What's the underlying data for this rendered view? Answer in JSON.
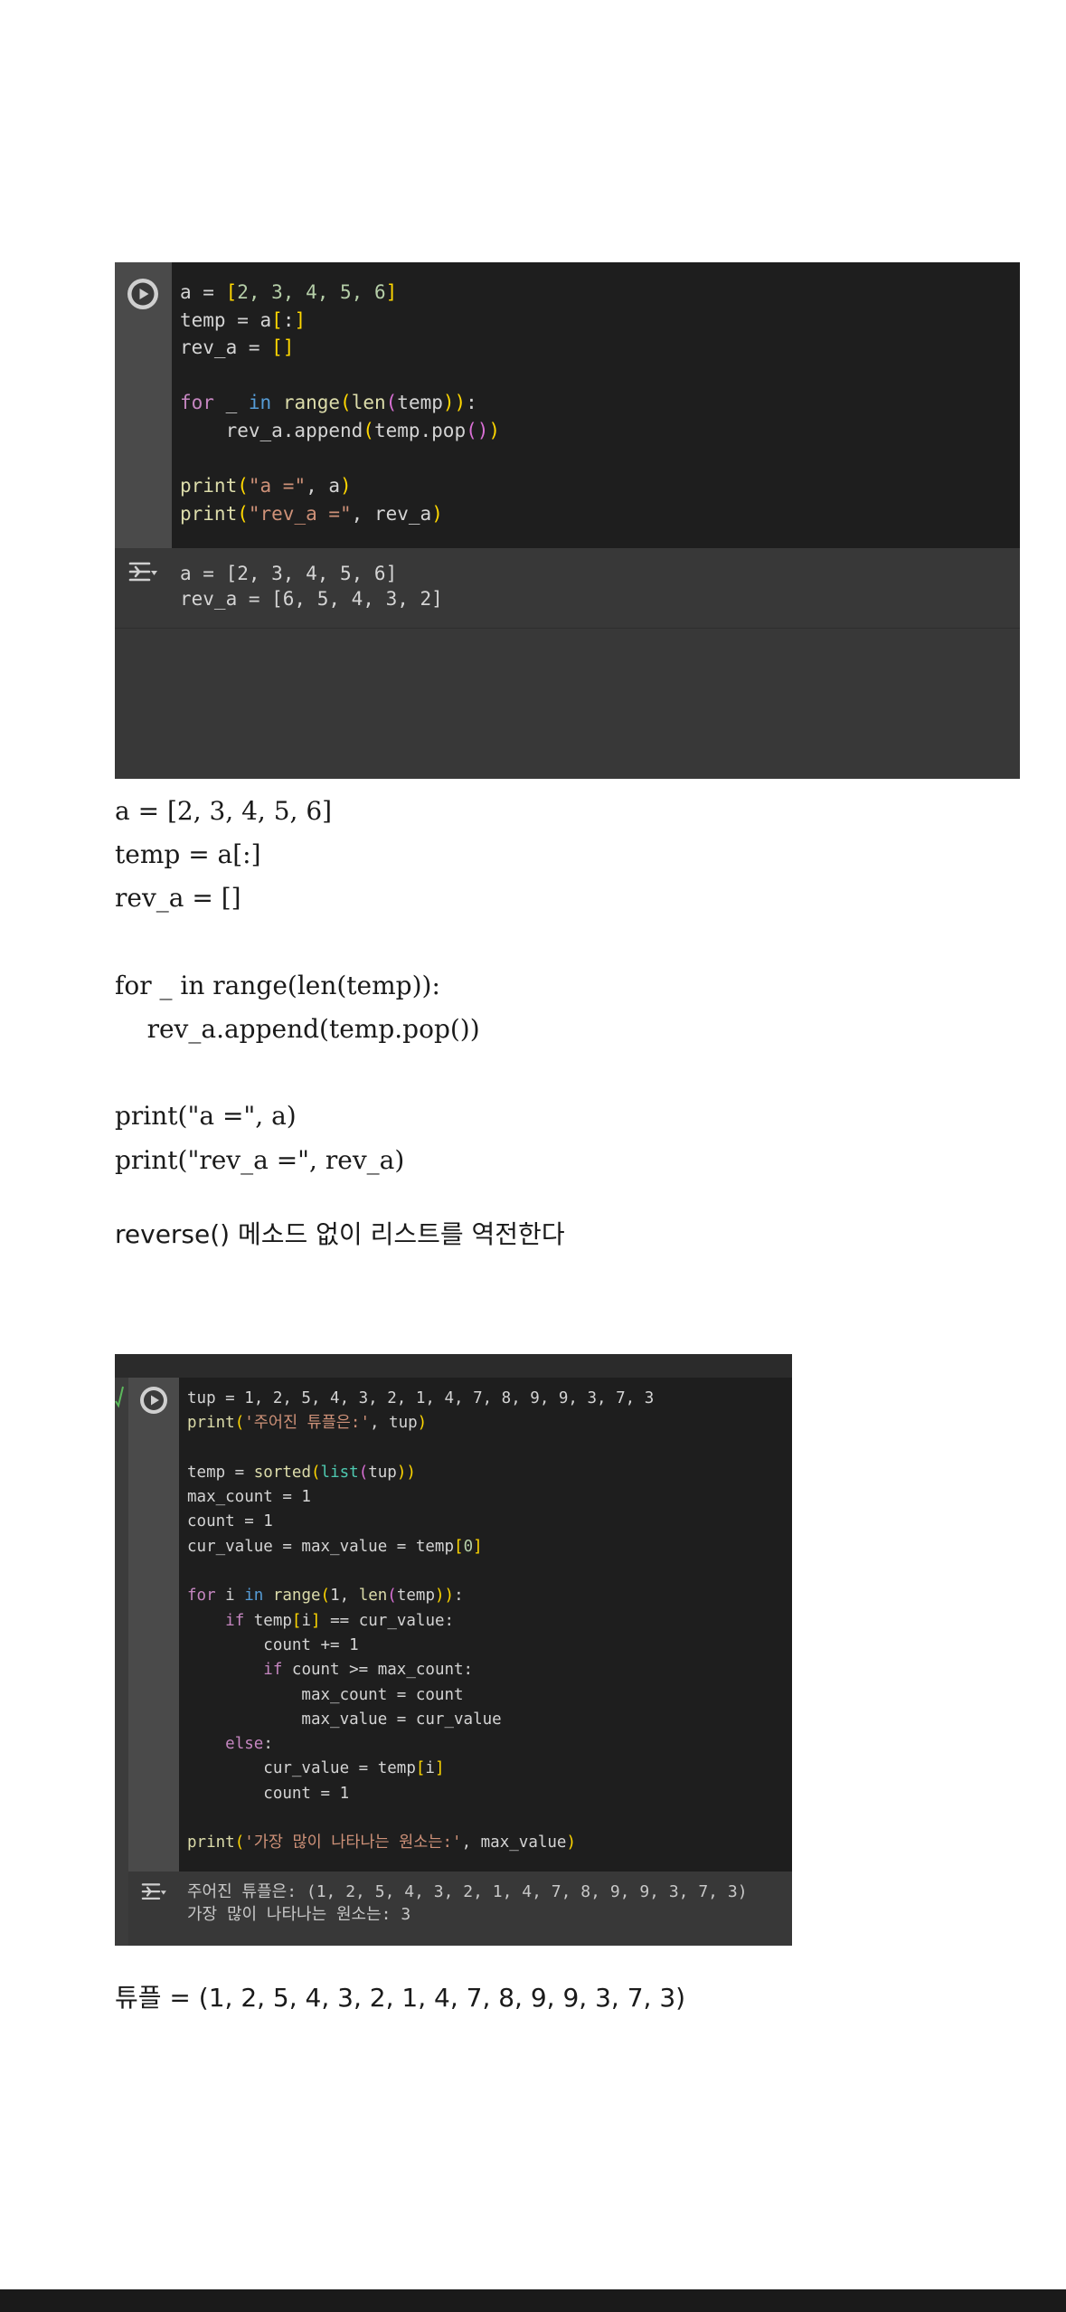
{
  "cell1": {
    "code": {
      "l1": {
        "a": "a = ",
        "b1": "[",
        "nums": "2, 3, 4, 5, 6",
        "b2": "]"
      },
      "l2": {
        "a": "temp = a",
        "b1": "[",
        "mid": ":",
        "b2": "]"
      },
      "l3": {
        "a": "rev_a = ",
        "b": "[]"
      },
      "l5": {
        "kw": "for",
        "a": " _ ",
        "in": "in",
        "sp": " ",
        "range": "range",
        "p1": "(",
        "len": "len",
        "p2": "(",
        "temp": "temp",
        "p3": "))",
        "colon": ":"
      },
      "l6": {
        "a": "    rev_a.append",
        "p1": "(",
        "b": "temp.pop",
        "p2": "()",
        "p3": ")"
      },
      "l8": {
        "fn": "print",
        "p1": "(",
        "str": "\"a =\"",
        "rest": ", a",
        "p2": ")"
      },
      "l9": {
        "fn": "print",
        "p1": "(",
        "str": "\"rev_a =\"",
        "rest": ", rev_a",
        "p2": ")"
      }
    },
    "output": [
      "a = [2, 3, 4, 5, 6]",
      "rev_a = [6, 5, 4, 3, 2]"
    ]
  },
  "explanation": [
    "a = [2, 3, 4, 5, 6]",
    "temp = a[:]",
    "rev_a = []",
    "",
    "for _ in range(len(temp)):",
    "    rev_a.append(temp.pop())",
    "",
    "print(\"a =\", a)",
    "print(\"rev_a =\", rev_a)"
  ],
  "description": "reverse() 메소드 없이 리스트를 역전한다",
  "cell2": {
    "code": {
      "l1": "tup = 1, 2, 5, 4, 3, 2, 1, 4, 7, 8, 9, 9, 3, 7, 3",
      "l2": {
        "fn": "print",
        "p1": "(",
        "str": "'주어진 튜플은:'",
        "rest": ", tup",
        "p2": ")"
      },
      "l4": {
        "a": "temp = ",
        "fn": "sorted",
        "p1": "(",
        "bi": "list",
        "p2": "(",
        "b": "tup",
        "p3": "))"
      },
      "l5": "max_count = 1",
      "l6": "count = 1",
      "l7": {
        "a": "cur_value = max_value = temp",
        "b1": "[",
        "n": "0",
        "b2": "]"
      },
      "l9": {
        "kw": "for",
        "a": " i ",
        "in": "in",
        "sp": " ",
        "range": "range",
        "p1": "(",
        "b": "1, ",
        "len": "len",
        "p2": "(",
        "t": "temp",
        "p3": "))",
        "c": ":"
      },
      "l10": {
        "ind": "    ",
        "kw": "if",
        "a": " temp",
        "b1": "[",
        "i": "i",
        "b2": "]",
        "rest": " == cur_value:"
      },
      "l11": "        count += 1",
      "l12": {
        "ind": "        ",
        "kw": "if",
        "rest": " count >= max_count:"
      },
      "l13": "            max_count = count",
      "l14": "            max_value = cur_value",
      "l15": {
        "ind": "    ",
        "kw": "else",
        "rest": ":"
      },
      "l16": {
        "a": "        cur_value = temp",
        "b1": "[",
        "i": "i",
        "b2": "]"
      },
      "l17": "        count = 1",
      "l19": {
        "fn": "print",
        "p1": "(",
        "str": "'가장 많이 나타나는 원소는:'",
        "rest": ", max_value",
        "p2": ")"
      }
    },
    "output": [
      "주어진 튜플은: (1, 2, 5, 4, 3, 2, 1, 4, 7, 8, 9, 9, 3, 7, 3)",
      "가장 많이 나타나는 원소는: 3"
    ]
  },
  "tuple_text": "튜플 = (1, 2, 5, 4, 3, 2, 1, 4, 7, 8, 9, 9, 3, 7, 3)",
  "icons": {
    "run": "play-icon",
    "output": "output-toggle-icon"
  },
  "colors": {
    "code_bg": "#1e1e1e",
    "gutter": "#4a4a4a",
    "output_bg": "#383838"
  }
}
